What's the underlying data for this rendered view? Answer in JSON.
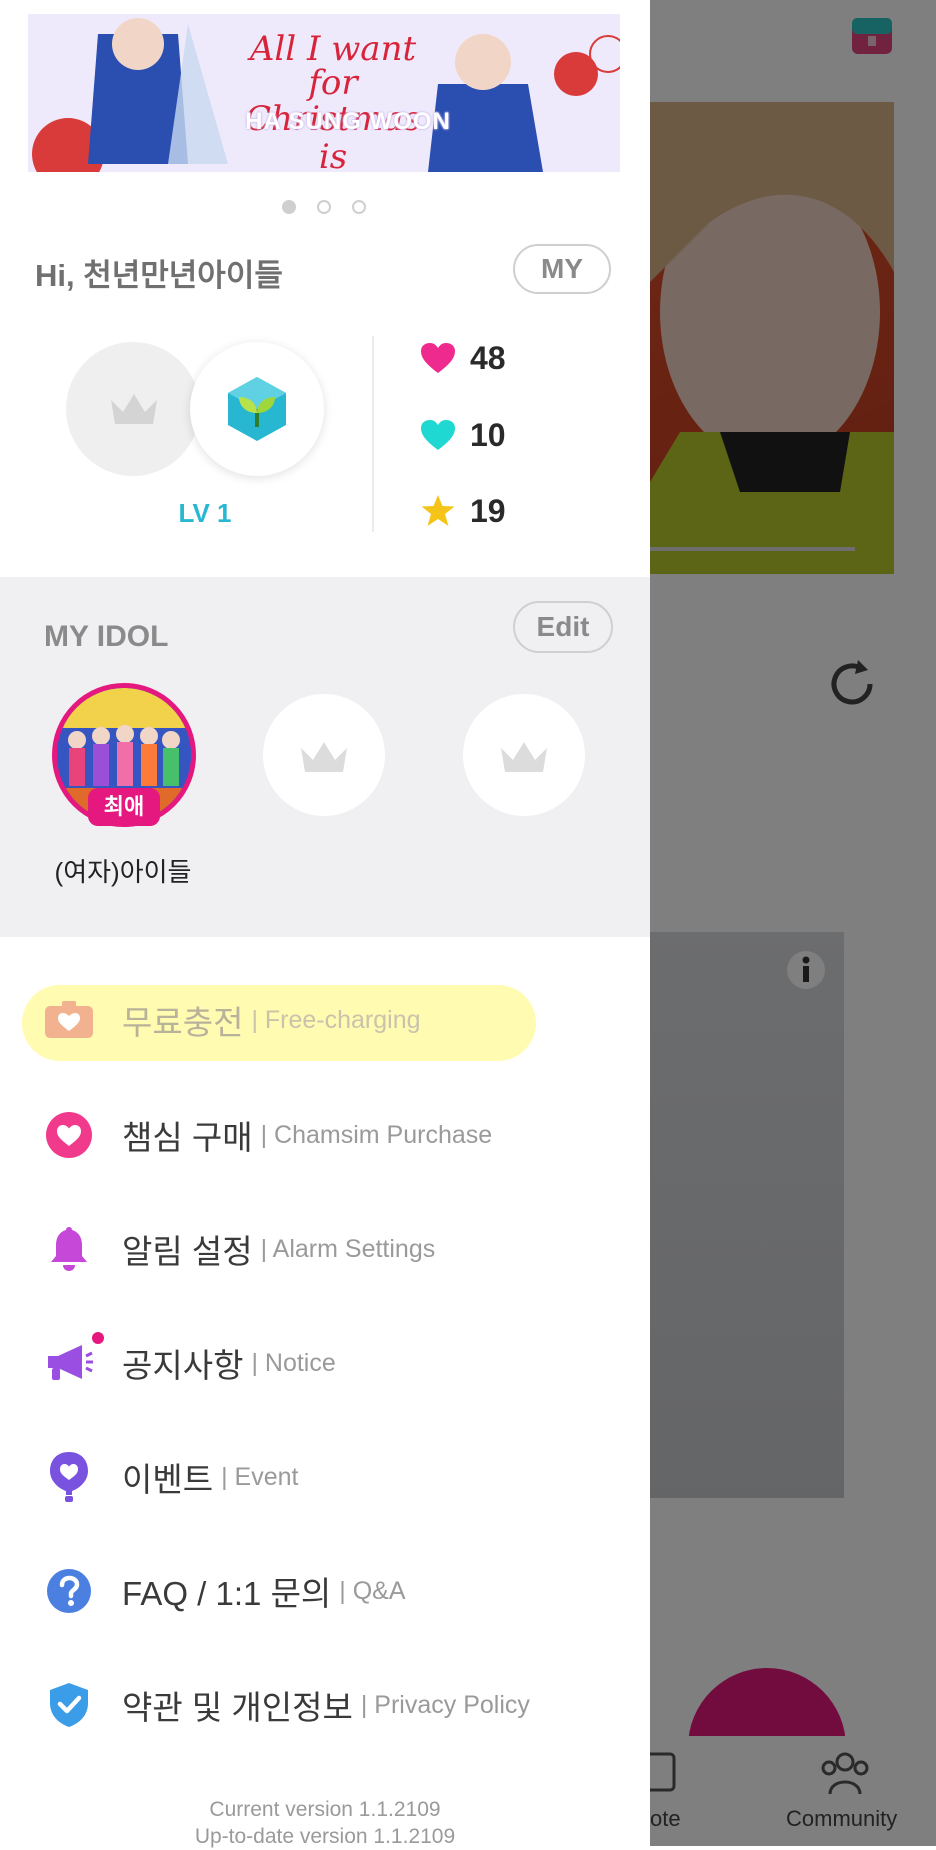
{
  "banner": {
    "line1": "All I want for",
    "line2": "Christmas is",
    "line3": "HA SUNG WOON",
    "page_count": 3,
    "active_page": 1
  },
  "profile": {
    "greeting": "Hi, 천년만년아이들",
    "my_button": "MY",
    "level": "LV 1",
    "stats": {
      "hearts_pink": "48",
      "hearts_teal": "10",
      "stars": "19"
    }
  },
  "my_idol": {
    "title": "MY IDOL",
    "edit_button": "Edit",
    "favorite": {
      "name": "(여자)아이들",
      "badge": "최애"
    }
  },
  "menu": [
    {
      "kr": "무료충전",
      "en": "| Free-charging",
      "icon": "free-charging-icon"
    },
    {
      "kr": "챔심 구매",
      "en": "| Chamsim Purchase",
      "icon": "heart-icon"
    },
    {
      "kr": "알림 설정",
      "en": "| Alarm Settings",
      "icon": "bell-icon"
    },
    {
      "kr": "공지사항",
      "en": "| Notice",
      "icon": "megaphone-icon"
    },
    {
      "kr": "이벤트",
      "en": "| Event",
      "icon": "balloon-heart-icon"
    },
    {
      "kr": "FAQ / 1:1 문의",
      "en": "| Q&A",
      "icon": "question-icon"
    },
    {
      "kr": "약관 및 개인정보",
      "en": "| Privacy Policy",
      "icon": "shield-check-icon"
    }
  ],
  "version": {
    "current": "Current version 1.1.2109",
    "latest": "Up-to-date version 1.1.2109"
  },
  "background": {
    "nav_vote_partial": "ote",
    "nav_community": "Community"
  },
  "colors": {
    "accent_pink": "#e4187e",
    "level_teal": "#27b7d1",
    "highlight": "#fffbb0"
  }
}
